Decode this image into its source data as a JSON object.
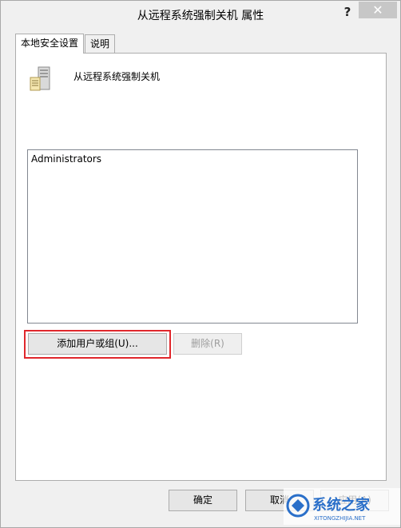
{
  "window": {
    "title": "从远程系统强制关机 属性",
    "help_label": "?",
    "close_label": "✕"
  },
  "tabs": [
    {
      "label": "本地安全设置",
      "active": true
    },
    {
      "label": "说明",
      "active": false
    }
  ],
  "policy": {
    "icon": "server-icon",
    "name": "从远程系统强制关机"
  },
  "members": [
    "Administrators"
  ],
  "buttons": {
    "add": "添加用户或组(U)...",
    "remove": "删除(R)"
  },
  "footer": {
    "ok": "确定",
    "cancel": "取消",
    "apply": "应用(A)"
  },
  "watermark": {
    "main": "系统之家",
    "sub": "XITONGZHIJIA.NET"
  },
  "colors": {
    "highlight": "#e0272c",
    "close_bg": "#c7c7c7",
    "watermark": "#2a6fc9"
  }
}
